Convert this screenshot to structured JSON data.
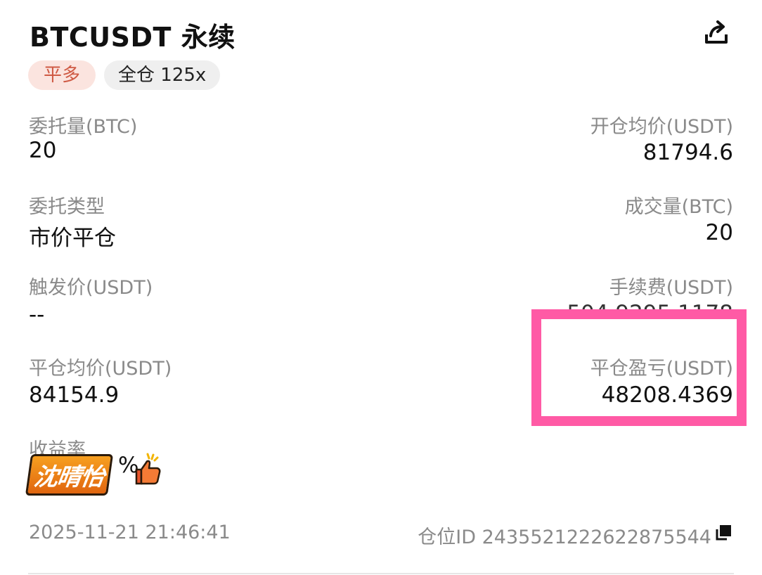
{
  "header": {
    "title": "BTCUSDT 永续",
    "share_icon": "share-icon"
  },
  "tags": {
    "side": "平多",
    "margin_mode": "全仓 125x"
  },
  "fields": {
    "order_qty": {
      "label": "委托量(BTC)",
      "value": "20"
    },
    "open_avg_price": {
      "label": "开仓均价(USDT)",
      "value": "81794.6"
    },
    "order_type": {
      "label": "委托类型",
      "value": "市价平仓"
    },
    "filled_qty": {
      "label": "成交量(BTC)",
      "value": "20"
    },
    "trigger_price": {
      "label": "触发价(USDT)",
      "value": "--"
    },
    "fee": {
      "label": "手续费(USDT)"
    },
    "close_avg_price": {
      "label": "平仓均价(USDT)",
      "value": "84154.9"
    },
    "close_pnl": {
      "label": "平仓盈亏(USDT)",
      "value": "48208.4369"
    },
    "roi": {
      "label": "收益率",
      "value_suffix": "%"
    }
  },
  "sticker": {
    "text": "沈晴怡"
  },
  "footer": {
    "timestamp": "2025-11-21 21:46:41",
    "position_id": "仓位ID 2435521222622875544",
    "copy_icon": "copy-icon"
  },
  "colors": {
    "highlight": "#ff5aa5",
    "tag_side_bg": "#fbe4df",
    "tag_side_text": "#cf5a44",
    "label_gray": "#8a8a8a"
  }
}
